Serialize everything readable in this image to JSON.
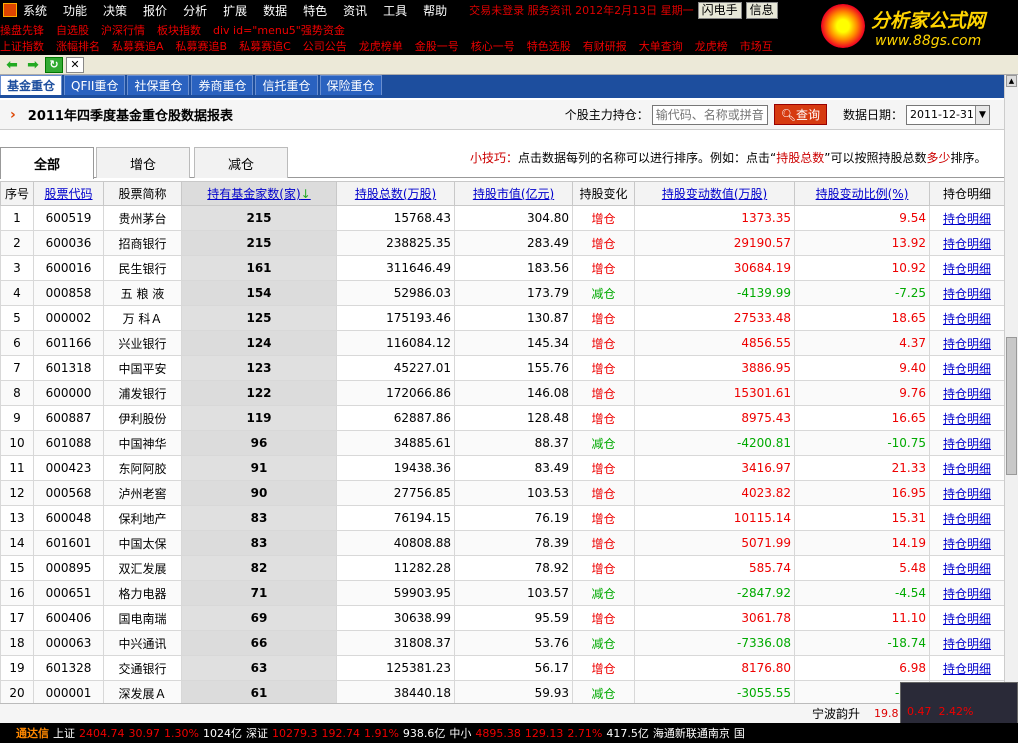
{
  "menu": [
    "系统",
    "功能",
    "决策",
    "报价",
    "分析",
    "扩展",
    "数据",
    "特色",
    "资讯",
    "工具",
    "帮助"
  ],
  "menu_ticker": "交易未登录  服务资讯  2012年2月13日 星期一",
  "menu_buttons": [
    "闪电手",
    "信息"
  ],
  "red_row1": [
    "操盘先锋",
    "自选股",
    "沪深行情",
    "板块指数",
    "div id=\"menu5\"强势资金"
  ],
  "red_row2": [
    "上证指数",
    "涨幅排名",
    "私募赛追A",
    "私募赛追B",
    "私募赛追C",
    "公司公告",
    "龙虎榜单",
    "金股一号",
    "核心一号",
    "特色选股",
    "有财研报",
    "大单查询",
    "龙虎榜",
    "市场互"
  ],
  "brand": {
    "title": "分析家公式网",
    "url": "www.88gs.com"
  },
  "category_tabs": [
    "基金重仓",
    "QFII重仓",
    "社保重仓",
    "券商重仓",
    "信托重仓",
    "保险重仓"
  ],
  "report": {
    "title": "2011年四季度基金重仓股数据报表",
    "stock_label": "个股主力持仓：",
    "stock_placeholder": "输代码、名称或拼音",
    "query_button": "查询",
    "date_label": "数据日期：",
    "date_value": "2011-12-31"
  },
  "sub_tabs": [
    "全部",
    "增仓",
    "减仓"
  ],
  "tip": {
    "prefix": "小技巧：",
    "text1": "点击数据每列的名称可以进行排序。例如：点击“",
    "key1": "持股总数",
    "text2": "”可以按照持股总数",
    "key2": "多少",
    "text3": "排序。"
  },
  "columns": [
    "序号",
    "股票代码",
    "股票简称",
    "持有基金家数(家)",
    "持股总数(万股)",
    "持股市值(亿元)",
    "持股变化",
    "持股变动数值(万股)",
    "持股变动比例(%)",
    "持仓明细"
  ],
  "rows": [
    [
      "1",
      "600519",
      "贵州茅台",
      "215",
      "15768.43",
      "304.80",
      "增仓",
      "1373.35",
      "9.54",
      "持仓明细"
    ],
    [
      "2",
      "600036",
      "招商银行",
      "215",
      "238825.35",
      "283.49",
      "增仓",
      "29190.57",
      "13.92",
      "持仓明细"
    ],
    [
      "3",
      "600016",
      "民生银行",
      "161",
      "311646.49",
      "183.56",
      "增仓",
      "30684.19",
      "10.92",
      "持仓明细"
    ],
    [
      "4",
      "000858",
      "五 粮 液",
      "154",
      "52986.03",
      "173.79",
      "减仓",
      "-4139.99",
      "-7.25",
      "持仓明细"
    ],
    [
      "5",
      "000002",
      "万 科Ａ",
      "125",
      "175193.46",
      "130.87",
      "增仓",
      "27533.48",
      "18.65",
      "持仓明细"
    ],
    [
      "6",
      "601166",
      "兴业银行",
      "124",
      "116084.12",
      "145.34",
      "增仓",
      "4856.55",
      "4.37",
      "持仓明细"
    ],
    [
      "7",
      "601318",
      "中国平安",
      "123",
      "45227.01",
      "155.76",
      "增仓",
      "3886.95",
      "9.40",
      "持仓明细"
    ],
    [
      "8",
      "600000",
      "浦发银行",
      "122",
      "172066.86",
      "146.08",
      "增仓",
      "15301.61",
      "9.76",
      "持仓明细"
    ],
    [
      "9",
      "600887",
      "伊利股份",
      "119",
      "62887.86",
      "128.48",
      "增仓",
      "8975.43",
      "16.65",
      "持仓明细"
    ],
    [
      "10",
      "601088",
      "中国神华",
      "96",
      "34885.61",
      "88.37",
      "减仓",
      "-4200.81",
      "-10.75",
      "持仓明细"
    ],
    [
      "11",
      "000423",
      "东阿阿胶",
      "91",
      "19438.36",
      "83.49",
      "增仓",
      "3416.97",
      "21.33",
      "持仓明细"
    ],
    [
      "12",
      "000568",
      "泸州老窖",
      "90",
      "27756.85",
      "103.53",
      "增仓",
      "4023.82",
      "16.95",
      "持仓明细"
    ],
    [
      "13",
      "600048",
      "保利地产",
      "83",
      "76194.15",
      "76.19",
      "增仓",
      "10115.14",
      "15.31",
      "持仓明细"
    ],
    [
      "14",
      "601601",
      "中国太保",
      "83",
      "40808.88",
      "78.39",
      "增仓",
      "5071.99",
      "14.19",
      "持仓明细"
    ],
    [
      "15",
      "000895",
      "双汇发展",
      "82",
      "11282.28",
      "78.92",
      "增仓",
      "585.74",
      "5.48",
      "持仓明细"
    ],
    [
      "16",
      "000651",
      "格力电器",
      "71",
      "59903.95",
      "103.57",
      "减仓",
      "-2847.92",
      "-4.54",
      "持仓明细"
    ],
    [
      "17",
      "600406",
      "国电南瑞",
      "69",
      "30638.99",
      "95.59",
      "增仓",
      "3061.78",
      "11.10",
      "持仓明细"
    ],
    [
      "18",
      "000063",
      "中兴通讯",
      "66",
      "31808.37",
      "53.76",
      "减仓",
      "-7336.08",
      "-18.74",
      "持仓明细"
    ],
    [
      "19",
      "601328",
      "交通银行",
      "63",
      "125381.23",
      "56.17",
      "增仓",
      "8176.80",
      "6.98",
      "持仓明细"
    ],
    [
      "20",
      "000001",
      "深发展Ａ",
      "61",
      "38440.18",
      "59.93",
      "减仓",
      "-3055.55",
      "-7.36",
      "持仓明细"
    ]
  ],
  "lower_info": {
    "name": "宁波韵升",
    "val1": "19.8",
    "val2": "0.47",
    "val3": "2.42%"
  },
  "bottom_bar": [
    {
      "t": "通达信",
      "c": "app"
    },
    {
      "t": "上证",
      "c": "w"
    },
    {
      "t": "2404.74",
      "c": "red"
    },
    {
      "t": "30.97",
      "c": "red"
    },
    {
      "t": "1.30%",
      "c": "red"
    },
    {
      "t": "1024亿",
      "c": "w"
    },
    {
      "t": "深证",
      "c": "w"
    },
    {
      "t": "10279.3",
      "c": "red"
    },
    {
      "t": "192.74",
      "c": "red"
    },
    {
      "t": "1.91%",
      "c": "red"
    },
    {
      "t": "938.6亿",
      "c": "w"
    },
    {
      "t": "中小",
      "c": "w"
    },
    {
      "t": "4895.38",
      "c": "red"
    },
    {
      "t": "129.13",
      "c": "red"
    },
    {
      "t": "2.71%",
      "c": "red"
    },
    {
      "t": "417.5亿",
      "c": "w"
    },
    {
      "t": "海通新联通南京",
      "c": "w"
    },
    {
      "t": "国",
      "c": "w"
    }
  ],
  "colors": {
    "up": "#e00000",
    "down": "#00a000",
    "tab_bar": "#1d4e9e",
    "query": "#d63a10"
  }
}
